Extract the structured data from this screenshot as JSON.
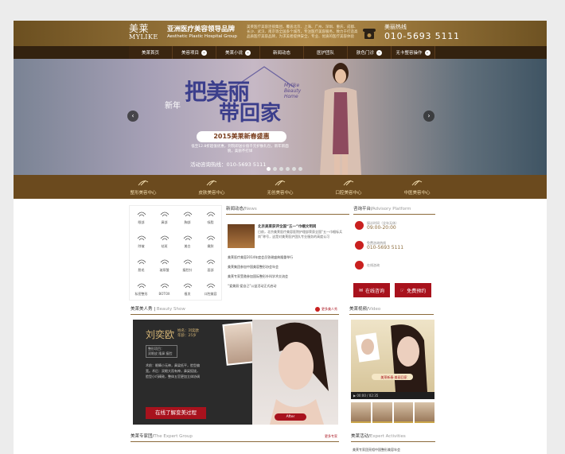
{
  "header": {
    "logo_script": "美莱",
    "logo_en": "MYLIKE",
    "hospital_cn": "亚洲医疗美容领导品牌",
    "hospital_en": "Aesthetic Plastic Hospital Group",
    "desc": "美莱医疗美容连锁集团，覆盖北京、上海、广州、深圳、重庆、成都、长沙、武汉、南京等全国多个城市，专注医疗美容服务，致力于打造高品质医疗美容品牌，为求美者提供安全、专业、优质的医疗美容体验",
    "hotline_label": "美丽热线",
    "hotline_number": "010-5693 5111"
  },
  "nav": {
    "items": [
      {
        "label": "美莱首页",
        "dropdown": false
      },
      {
        "label": "美容项目",
        "dropdown": true
      },
      {
        "label": "美莱小说",
        "dropdown": true
      },
      {
        "label": "新闻动态",
        "dropdown": false
      },
      {
        "label": "医护团队",
        "dropdown": false
      },
      {
        "label": "肤色门诊",
        "dropdown": true
      },
      {
        "label": "无卡整容操作",
        "dropdown": true
      }
    ]
  },
  "banner": {
    "newyear": "新年",
    "headline_1": "把美丽",
    "headline_2": "带回家",
    "brand_en": "Mylike Beauty Home",
    "pill": "2015美莱新春盛惠",
    "copy": "低至12.8折超值优惠，到院即送价值千元护肤礼包，新年新面貌，美丽不打烊",
    "activity": "活动咨询热线：010-5693 5111",
    "prev_label": "‹",
    "next_label": "›",
    "slide_count": 6,
    "active_slide": 0
  },
  "categories": [
    {
      "label": "整形美容中心",
      "icon": "scalpel-icon"
    },
    {
      "label": "皮肤美容中心",
      "icon": "skincare-icon"
    },
    {
      "label": "无创美容中心",
      "icon": "injection-icon"
    },
    {
      "label": "口腔美容中心",
      "icon": "tooth-icon"
    },
    {
      "label": "中医美容中心",
      "icon": "herbal-icon"
    }
  ],
  "projects": [
    {
      "label": "眼部",
      "icon": "eye-icon"
    },
    {
      "label": "鼻部",
      "icon": "nose-icon"
    },
    {
      "label": "胸部",
      "icon": "chest-icon"
    },
    {
      "label": "吸脂",
      "icon": "liposuction-icon"
    },
    {
      "label": "除皱",
      "icon": "wrinkle-icon"
    },
    {
      "label": "祛斑",
      "icon": "spot-icon"
    },
    {
      "label": "美白",
      "icon": "whitening-icon"
    },
    {
      "label": "嫩肤",
      "icon": "skin-icon"
    },
    {
      "label": "脱毛",
      "icon": "hair-removal-icon"
    },
    {
      "label": "玻尿酸",
      "icon": "hyaluronic-icon"
    },
    {
      "label": "瘦脸针",
      "icon": "face-slim-icon"
    },
    {
      "label": "面部",
      "icon": "face-icon"
    },
    {
      "label": "私密整形",
      "icon": "private-icon"
    },
    {
      "label": "BOTOX",
      "icon": "botox-icon"
    },
    {
      "label": "植发",
      "icon": "hair-transplant-icon"
    },
    {
      "label": "口腔美容",
      "icon": "dental-icon"
    }
  ],
  "news": {
    "title_cn": "新闻动态",
    "title_en": "News",
    "lead_title": "北京美莱获评全国“五一”巾帼文明岗",
    "lead_body": "日前，北京美莱医疗美容医院护理部荣获全国“五一巾帼标兵岗”称号，这是对美莱医护团队专业服务的高度认可",
    "items": [
      "美莱医疗美容2014年度会员答谢盛典隆重举行",
      "美莱集团参加中国美容整形协会年会",
      "美莱专家受邀参加国际整形外科学术交流会",
      "“爱美丽·爱自己”公益活动正式启动"
    ]
  },
  "consult": {
    "title_cn": "咨询平台",
    "title_en": "Advisory Platform",
    "hours_label": "接诊时间（全年无休）",
    "hours": "09:00-20:00",
    "phone_label": "免费咨询热线",
    "phone": "010-5693 5111",
    "online_label": "在线咨询",
    "btn_online": "在线咨询",
    "btn_book": "免费预约"
  },
  "beauty_show": {
    "title_cn": "美莱美人秀",
    "title_en": "Beauty Show",
    "more": "更多美人秀",
    "name": "刘奕欧",
    "age_line_1": "姓名：刘奕欧",
    "age_line_2": "年龄：25岁",
    "project_label": "整形项目：",
    "project": "双眼皮 隆鼻 瘦脸",
    "desc": "术前：眼睛小无神，鼻梁低平，脸型偏宽。术后：双眼大而有神，鼻梁挺拔，脸型小巧精致，整体五官更加立体协调",
    "cta": "在线了解变美过程",
    "after_label": "After"
  },
  "video": {
    "title_cn": "美莱视频",
    "title_en": "Video",
    "caption": "美莱新春·美丽回家",
    "player_time": "00:00 / 02:35"
  },
  "bottom": {
    "expert_cn": "美莱专家团",
    "expert_en": "The Expert Group",
    "expert_more": "更多专家",
    "activity_cn": "美莱活动",
    "activity_en": "Expert Activities",
    "activity_item": "美莱专家团亮相中国整形美容年会"
  }
}
